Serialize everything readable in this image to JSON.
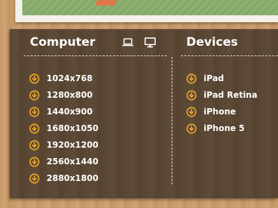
{
  "columns": {
    "computer": {
      "title": "Computer",
      "header_icons": [
        "laptop-icon",
        "monitor-icon"
      ],
      "items": [
        "1024x768",
        "1280x800",
        "1440x900",
        "1680x1050",
        "1920x1200",
        "2560x1440",
        "2880x1800"
      ]
    },
    "devices": {
      "title": "Devices",
      "items": [
        "iPad",
        "iPad Retina",
        "iPhone",
        "iPhone 5"
      ]
    }
  },
  "item_icon": "download-icon",
  "colors": {
    "accent": "#e8a426",
    "panel": "#5a4736",
    "wood": "#c89a6a",
    "text": "#ffffff"
  }
}
